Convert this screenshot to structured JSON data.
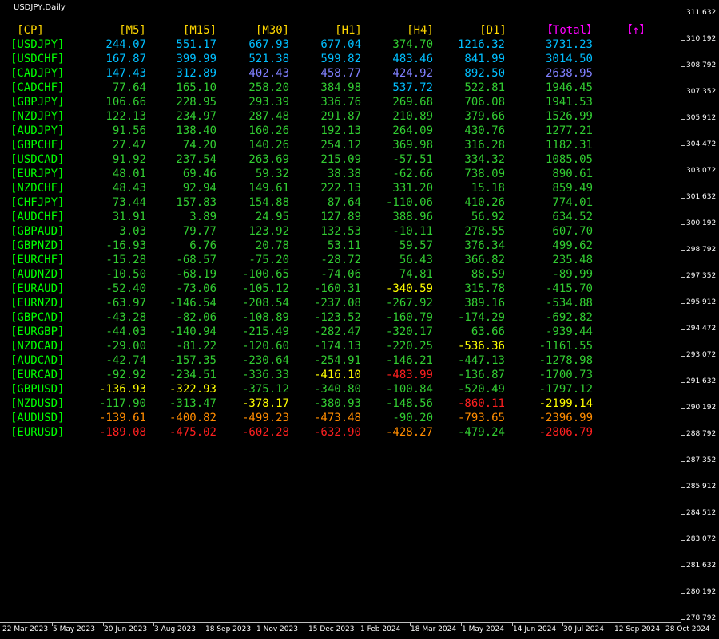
{
  "chart_title": "USDJPY,Daily",
  "colors": {
    "background": "#000000",
    "header": "#ffd700",
    "pair": "#00ff00",
    "total_header": "#ff00ff",
    "strong": "#00bfff",
    "strong2": "#00bfff",
    "medium": "#8080ff",
    "positive": "#32cd32",
    "negative": "#32cd32",
    "weak": "#ffff00",
    "weaker": "#ff8c00",
    "weakest": "#ff2020"
  },
  "table": {
    "headers": [
      "[CP]",
      "[M5]",
      "[M15]",
      "[M30]",
      "[H1]",
      "[H4]",
      "[D1]",
      "【Total】",
      "【↑】"
    ],
    "rows": [
      {
        "pair": "[USDJPY]",
        "values": [
          "244.07",
          "551.17",
          "667.93",
          "677.04",
          "374.70",
          "1216.32",
          "3731.23"
        ],
        "c": [
          "s",
          "s",
          "s",
          "s",
          "p",
          "s",
          "s"
        ]
      },
      {
        "pair": "[USDCHF]",
        "values": [
          "167.87",
          "399.99",
          "521.38",
          "599.82",
          "483.46",
          "841.99",
          "3014.50"
        ],
        "c": [
          "s",
          "s",
          "s",
          "s",
          "s",
          "s",
          "s"
        ]
      },
      {
        "pair": "[CADJPY]",
        "values": [
          "147.43",
          "312.89",
          "402.43",
          "458.77",
          "424.92",
          "892.50",
          "2638.95"
        ],
        "c": [
          "s",
          "s",
          "m",
          "m",
          "m",
          "s",
          "m"
        ]
      },
      {
        "pair": "[CADCHF]",
        "values": [
          "77.64",
          "165.10",
          "258.20",
          "384.98",
          "537.72",
          "522.81",
          "1946.45"
        ],
        "c": [
          "p",
          "p",
          "p",
          "p",
          "s",
          "p",
          "p"
        ]
      },
      {
        "pair": "[GBPJPY]",
        "values": [
          "106.66",
          "228.95",
          "293.39",
          "336.76",
          "269.68",
          "706.08",
          "1941.53"
        ],
        "c": [
          "p",
          "p",
          "p",
          "p",
          "p",
          "p",
          "p"
        ]
      },
      {
        "pair": "[NZDJPY]",
        "values": [
          "122.13",
          "234.97",
          "287.48",
          "291.87",
          "210.89",
          "379.66",
          "1526.99"
        ],
        "c": [
          "p",
          "p",
          "p",
          "p",
          "p",
          "p",
          "p"
        ]
      },
      {
        "pair": "[AUDJPY]",
        "values": [
          "91.56",
          "138.40",
          "160.26",
          "192.13",
          "264.09",
          "430.76",
          "1277.21"
        ],
        "c": [
          "p",
          "p",
          "p",
          "p",
          "p",
          "p",
          "p"
        ]
      },
      {
        "pair": "[GBPCHF]",
        "values": [
          "27.47",
          "74.20",
          "140.26",
          "254.12",
          "369.98",
          "316.28",
          "1182.31"
        ],
        "c": [
          "p",
          "p",
          "p",
          "p",
          "p",
          "p",
          "p"
        ]
      },
      {
        "pair": "[USDCAD]",
        "values": [
          "91.92",
          "237.54",
          "263.69",
          "215.09",
          "-57.51",
          "334.32",
          "1085.05"
        ],
        "c": [
          "p",
          "p",
          "p",
          "p",
          "p",
          "p",
          "p"
        ]
      },
      {
        "pair": "[EURJPY]",
        "values": [
          "48.01",
          "69.46",
          "59.32",
          "38.38",
          "-62.66",
          "738.09",
          "890.61"
        ],
        "c": [
          "p",
          "p",
          "p",
          "p",
          "p",
          "p",
          "p"
        ]
      },
      {
        "pair": "[NZDCHF]",
        "values": [
          "48.43",
          "92.94",
          "149.61",
          "222.13",
          "331.20",
          "15.18",
          "859.49"
        ],
        "c": [
          "p",
          "p",
          "p",
          "p",
          "p",
          "p",
          "p"
        ]
      },
      {
        "pair": "[CHFJPY]",
        "values": [
          "73.44",
          "157.83",
          "154.88",
          "87.64",
          "-110.06",
          "410.26",
          "774.01"
        ],
        "c": [
          "p",
          "p",
          "p",
          "p",
          "p",
          "p",
          "p"
        ]
      },
      {
        "pair": "[AUDCHF]",
        "values": [
          "31.91",
          "3.89",
          "24.95",
          "127.89",
          "388.96",
          "56.92",
          "634.52"
        ],
        "c": [
          "p",
          "p",
          "p",
          "p",
          "p",
          "p",
          "p"
        ]
      },
      {
        "pair": "[GBPAUD]",
        "values": [
          "3.03",
          "79.77",
          "123.92",
          "132.53",
          "-10.11",
          "278.55",
          "607.70"
        ],
        "c": [
          "p",
          "p",
          "p",
          "p",
          "p",
          "p",
          "p"
        ]
      },
      {
        "pair": "[GBPNZD]",
        "values": [
          "-16.93",
          "6.76",
          "20.78",
          "53.11",
          "59.57",
          "376.34",
          "499.62"
        ],
        "c": [
          "p",
          "p",
          "p",
          "p",
          "p",
          "p",
          "p"
        ]
      },
      {
        "pair": "[EURCHF]",
        "values": [
          "-15.28",
          "-68.57",
          "-75.20",
          "-28.72",
          "56.43",
          "366.82",
          "235.48"
        ],
        "c": [
          "p",
          "p",
          "p",
          "p",
          "p",
          "p",
          "p"
        ]
      },
      {
        "pair": "[AUDNZD]",
        "values": [
          "-10.50",
          "-68.19",
          "-100.65",
          "-74.06",
          "74.81",
          "88.59",
          "-89.99"
        ],
        "c": [
          "p",
          "p",
          "p",
          "p",
          "p",
          "p",
          "p"
        ]
      },
      {
        "pair": "[EURAUD]",
        "values": [
          "-52.40",
          "-73.06",
          "-105.12",
          "-160.31",
          "-340.59",
          "315.78",
          "-415.70"
        ],
        "c": [
          "p",
          "p",
          "p",
          "p",
          "y",
          "p",
          "p"
        ]
      },
      {
        "pair": "[EURNZD]",
        "values": [
          "-63.97",
          "-146.54",
          "-208.54",
          "-237.08",
          "-267.92",
          "389.16",
          "-534.88"
        ],
        "c": [
          "p",
          "p",
          "p",
          "p",
          "p",
          "p",
          "p"
        ]
      },
      {
        "pair": "[GBPCAD]",
        "values": [
          "-43.28",
          "-82.06",
          "-108.89",
          "-123.52",
          "-160.79",
          "-174.29",
          "-692.82"
        ],
        "c": [
          "p",
          "p",
          "p",
          "p",
          "p",
          "p",
          "p"
        ]
      },
      {
        "pair": "[EURGBP]",
        "values": [
          "-44.03",
          "-140.94",
          "-215.49",
          "-282.47",
          "-320.17",
          "63.66",
          "-939.44"
        ],
        "c": [
          "p",
          "p",
          "p",
          "p",
          "p",
          "p",
          "p"
        ]
      },
      {
        "pair": "[NZDCAD]",
        "values": [
          "-29.00",
          "-81.22",
          "-120.60",
          "-174.13",
          "-220.25",
          "-536.36",
          "-1161.55"
        ],
        "c": [
          "p",
          "p",
          "p",
          "p",
          "p",
          "y",
          "p"
        ]
      },
      {
        "pair": "[AUDCAD]",
        "values": [
          "-42.74",
          "-157.35",
          "-230.64",
          "-254.91",
          "-146.21",
          "-447.13",
          "-1278.98"
        ],
        "c": [
          "p",
          "p",
          "p",
          "p",
          "p",
          "p",
          "p"
        ]
      },
      {
        "pair": "[EURCAD]",
        "values": [
          "-92.92",
          "-234.51",
          "-336.33",
          "-416.10",
          "-483.99",
          "-136.87",
          "-1700.73"
        ],
        "c": [
          "p",
          "p",
          "p",
          "y",
          "r",
          "p",
          "p"
        ]
      },
      {
        "pair": "[GBPUSD]",
        "values": [
          "-136.93",
          "-322.93",
          "-375.12",
          "-340.80",
          "-100.84",
          "-520.49",
          "-1797.12"
        ],
        "c": [
          "y",
          "y",
          "p",
          "p",
          "p",
          "p",
          "p"
        ]
      },
      {
        "pair": "[NZDUSD]",
        "values": [
          "-117.90",
          "-313.47",
          "-378.17",
          "-380.93",
          "-148.56",
          "-860.11",
          "-2199.14"
        ],
        "c": [
          "p",
          "p",
          "y",
          "p",
          "p",
          "r",
          "y"
        ]
      },
      {
        "pair": "[AUDUSD]",
        "values": [
          "-139.61",
          "-400.82",
          "-499.23",
          "-473.48",
          "-90.20",
          "-793.65",
          "-2396.99"
        ],
        "c": [
          "o",
          "o",
          "o",
          "o",
          "p",
          "o",
          "o"
        ]
      },
      {
        "pair": "[EURUSD]",
        "values": [
          "-189.08",
          "-475.02",
          "-602.28",
          "-632.90",
          "-428.27",
          "-479.24",
          "-2806.79"
        ],
        "c": [
          "r",
          "r",
          "r",
          "r",
          "o",
          "p",
          "r"
        ]
      }
    ]
  },
  "price_axis": [
    "311.632",
    "310.192",
    "308.792",
    "307.352",
    "305.912",
    "304.472",
    "303.072",
    "301.632",
    "300.192",
    "298.792",
    "297.352",
    "295.912",
    "294.472",
    "293.072",
    "291.632",
    "290.192",
    "288.792",
    "287.352",
    "285.912",
    "284.512",
    "283.072",
    "281.632",
    "280.192",
    "278.792"
  ],
  "time_axis": [
    "22 Mar 2023",
    "5 May 2023",
    "20 Jun 2023",
    "3 Aug 2023",
    "18 Sep 2023",
    "1 Nov 2023",
    "15 Dec 2023",
    "1 Feb 2024",
    "18 Mar 2024",
    "1 May 2024",
    "14 Jun 2024",
    "30 Jul 2024",
    "12 Sep 2024",
    "28 Oct 2024"
  ]
}
